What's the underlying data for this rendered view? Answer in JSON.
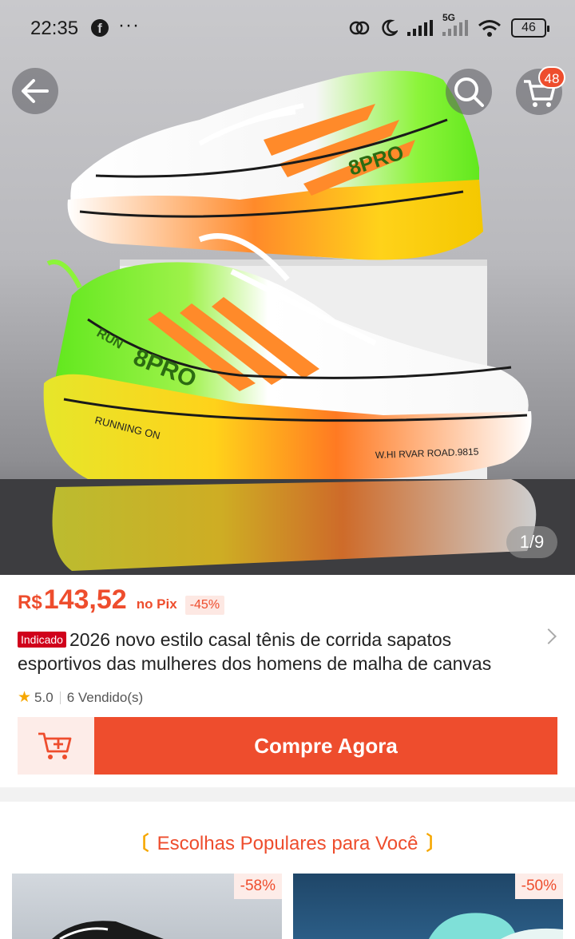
{
  "status_bar": {
    "time": "22:35",
    "network": "5G",
    "battery": "46"
  },
  "header": {
    "cart_count": "48"
  },
  "gallery": {
    "page_indicator": "1/9",
    "shoe_text_1": "8PRO",
    "shoe_text_2": "RUN",
    "shoe_text_3": "RUNNING ON",
    "shoe_text_4": "W.HI RVAR ROAD.9815"
  },
  "product": {
    "currency": "R$",
    "price": "143,52",
    "payment_method": "no Pix",
    "discount": "-45%",
    "tag": "Indicado",
    "title": "2026 novo estilo casal tênis de corrida sapatos esportivos das mulheres dos homens de malha de canvas",
    "rating": "5.0",
    "sold": "6 Vendido(s)"
  },
  "actions": {
    "buy_now": "Compre Agora"
  },
  "popular": {
    "title": "Escolhas Populares para Você",
    "items": [
      {
        "discount": "-58%"
      },
      {
        "discount": "-50%"
      }
    ]
  },
  "colors": {
    "accent": "#ee4d2d",
    "star": "#f6a700"
  }
}
